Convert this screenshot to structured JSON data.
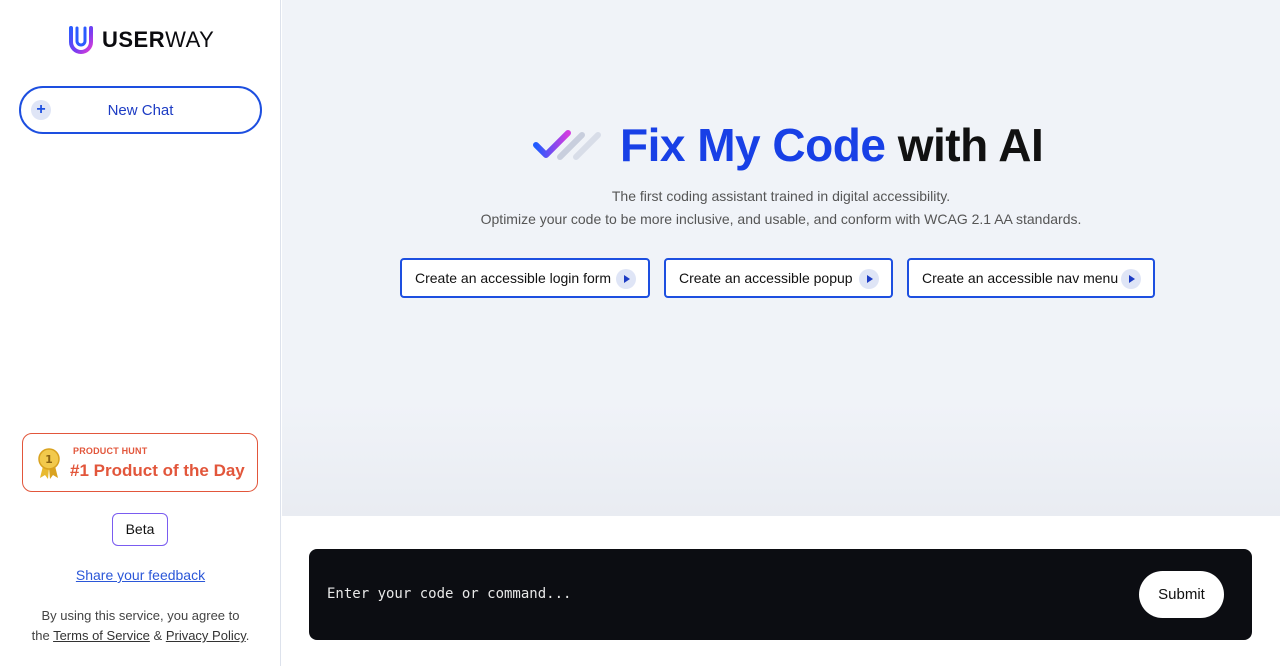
{
  "sidebar": {
    "logo": {
      "part1": "USER",
      "part2": "WAY"
    },
    "new_chat_label": "New Chat",
    "product_hunt": {
      "small": "PRODUCT HUNT",
      "big": "#1 Product of the Day"
    },
    "beta_label": "Beta",
    "feedback_link": "Share your feedback",
    "terms": {
      "line1": "By using this service, you agree to",
      "prefix": "the",
      "tos": "Terms of Service",
      "amp": "&",
      "privacy": "Privacy Policy",
      "suffix": "."
    }
  },
  "main": {
    "title_blue": "Fix My Code",
    "title_rest": "with AI",
    "subtitle1": "The first coding assistant trained in digital accessibility.",
    "subtitle2": "Optimize your code to be more inclusive, and usable, and conform with WCAG 2.1 AA standards.",
    "suggestions": [
      "Create an accessible login form",
      "Create an accessible popup",
      "Create an accessible nav menu"
    ]
  },
  "input": {
    "placeholder": "Enter your code or command...",
    "submit_label": "Submit"
  },
  "colors": {
    "accent": "#1d4fe0",
    "product_hunt": "#e2563b",
    "input_bg": "#0c0d12"
  }
}
